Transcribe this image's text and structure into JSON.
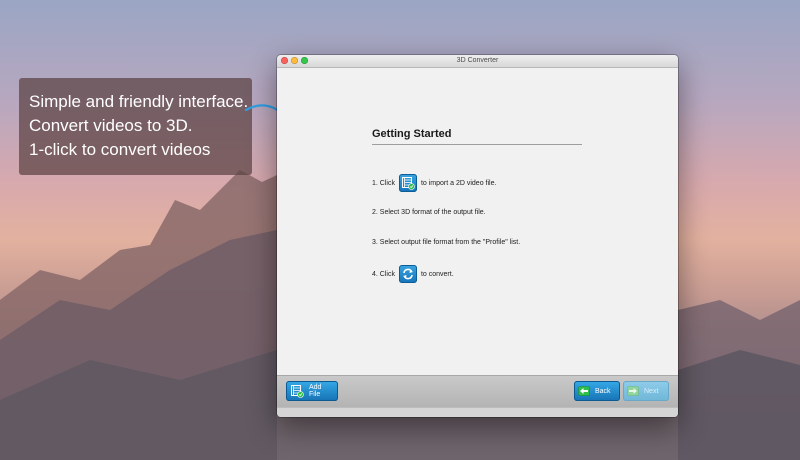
{
  "promo": {
    "lines": [
      "Simple and friendly interface.",
      "Convert videos to 3D.",
      "1-click to convert videos"
    ]
  },
  "window": {
    "title": "3D Converter"
  },
  "getting_started": {
    "heading": "Getting Started",
    "step1_before": "1. Click",
    "step1_after": "to import a 2D video file.",
    "step2": "2. Select 3D format of the output file.",
    "step3": "3. Select output file format from the \"Profile\" list.",
    "step4_before": "4. Click",
    "step4_after": "to convert."
  },
  "toolbar": {
    "add_file_label": "Add File",
    "back_label": "Back",
    "next_label": "Next"
  },
  "colors": {
    "accent": "#1f8fd1",
    "disabled": "#7fc0e0"
  },
  "icons": {
    "add_file": "film-add-icon",
    "convert": "convert-arrows-icon",
    "back": "arrow-left-icon",
    "next": "arrow-right-icon"
  }
}
